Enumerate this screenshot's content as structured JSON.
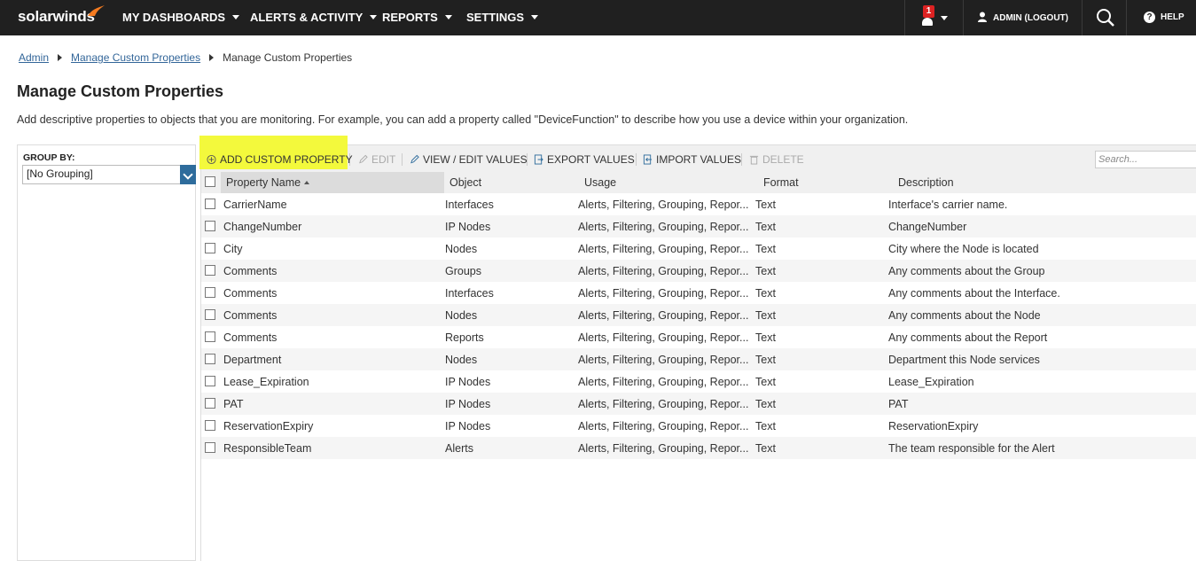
{
  "nav": {
    "logo": "solarwinds",
    "items": [
      {
        "label": "MY DASHBOARDS"
      },
      {
        "label": "ALERTS & ACTIVITY"
      },
      {
        "label": "REPORTS"
      },
      {
        "label": "SETTINGS"
      }
    ],
    "alert_count": "1",
    "user_label": "ADMIN (LOGOUT)",
    "help_label": "HELP"
  },
  "breadcrumb": {
    "items": [
      "Admin",
      "Manage Custom Properties",
      "Manage Custom Properties"
    ]
  },
  "page": {
    "title": "Manage Custom Properties",
    "description": "Add descriptive properties to objects that you are monitoring. For example, you can add a property called \"DeviceFunction\" to describe how you use a device within your organization."
  },
  "groupby": {
    "label": "GROUP BY:",
    "value": "[No Grouping]"
  },
  "toolbar": {
    "add": "ADD CUSTOM PROPERTY",
    "edit": "EDIT",
    "view_edit": "VIEW / EDIT VALUES",
    "export": "EXPORT VALUES",
    "import": "IMPORT VALUES",
    "delete": "DELETE",
    "search_placeholder": "Search..."
  },
  "columns": [
    "Property Name",
    "Object",
    "Usage",
    "Format",
    "Description"
  ],
  "rows": [
    [
      "CarrierName",
      "Interfaces",
      "Alerts, Filtering, Grouping, Repor...",
      "Text",
      "Interface's carrier name."
    ],
    [
      "ChangeNumber",
      "IP Nodes",
      "Alerts, Filtering, Grouping, Repor...",
      "Text",
      "ChangeNumber"
    ],
    [
      "City",
      "Nodes",
      "Alerts, Filtering, Grouping, Repor...",
      "Text",
      "City where the Node is located"
    ],
    [
      "Comments",
      "Groups",
      "Alerts, Filtering, Grouping, Repor...",
      "Text",
      "Any comments about the Group"
    ],
    [
      "Comments",
      "Interfaces",
      "Alerts, Filtering, Grouping, Repor...",
      "Text",
      "Any comments about the Interface."
    ],
    [
      "Comments",
      "Nodes",
      "Alerts, Filtering, Grouping, Repor...",
      "Text",
      "Any comments about the Node"
    ],
    [
      "Comments",
      "Reports",
      "Alerts, Filtering, Grouping, Repor...",
      "Text",
      "Any comments about the Report"
    ],
    [
      "Department",
      "Nodes",
      "Alerts, Filtering, Grouping, Repor...",
      "Text",
      "Department this Node services"
    ],
    [
      "Lease_Expiration",
      "IP Nodes",
      "Alerts, Filtering, Grouping, Repor...",
      "Text",
      "Lease_Expiration"
    ],
    [
      "PAT",
      "IP Nodes",
      "Alerts, Filtering, Grouping, Repor...",
      "Text",
      "PAT"
    ],
    [
      "ReservationExpiry",
      "IP Nodes",
      "Alerts, Filtering, Grouping, Repor...",
      "Text",
      "ReservationExpiry"
    ],
    [
      "ResponsibleTeam",
      "Alerts",
      "Alerts, Filtering, Grouping, Repor...",
      "Text",
      "The team responsible for the Alert"
    ]
  ],
  "colors": {
    "topbar": "#202020",
    "highlight": "#f3f93c",
    "link": "#336699",
    "dropdown": "#2e6c9c"
  }
}
